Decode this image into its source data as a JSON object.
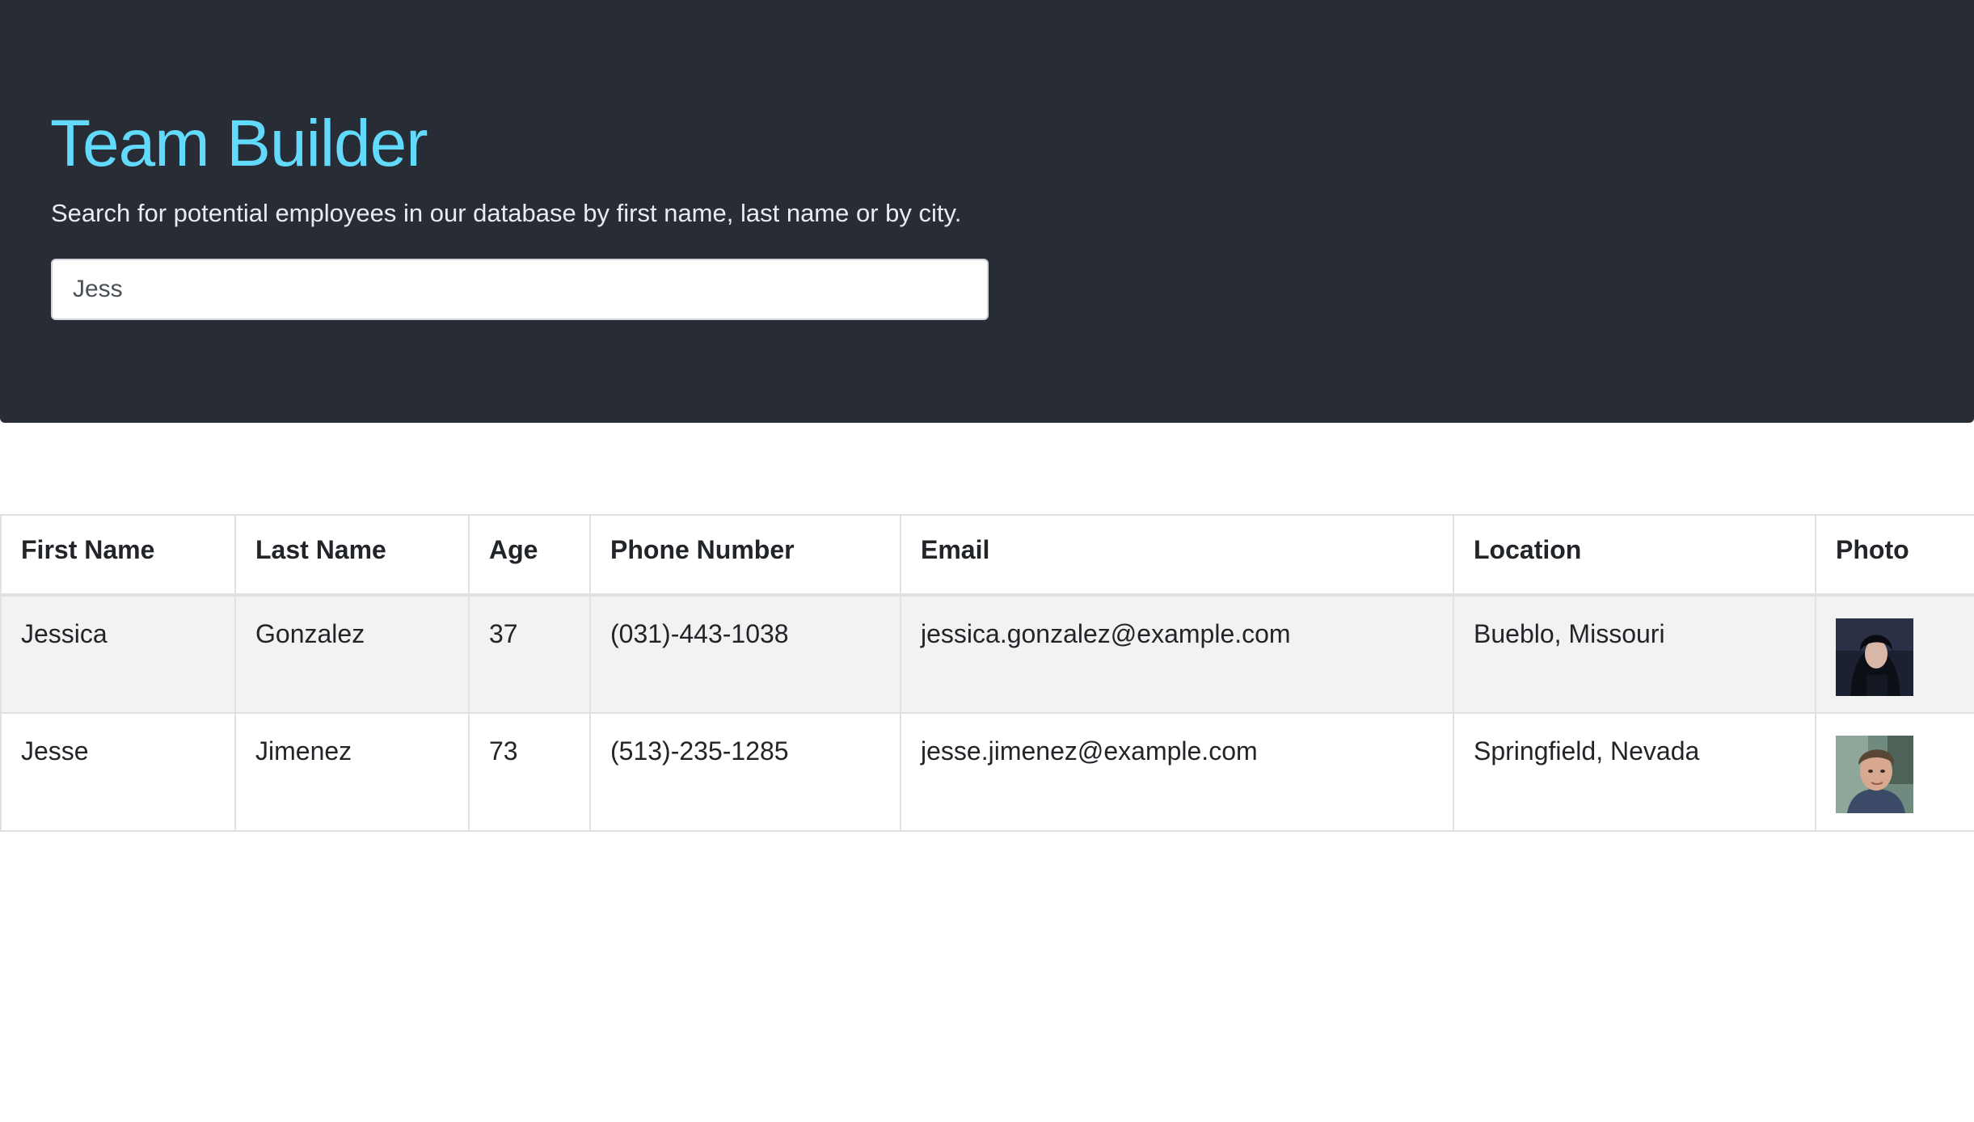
{
  "header": {
    "title": "Team Builder",
    "subtitle": "Search for potential employees in our database by first name, last name or by city.",
    "title_color": "#61dafb",
    "background_color": "#282c34"
  },
  "search": {
    "value": "Jess",
    "placeholder": ""
  },
  "table": {
    "columns": [
      "First Name",
      "Last Name",
      "Age",
      "Phone Number",
      "Email",
      "Location",
      "Photo"
    ],
    "rows": [
      {
        "first_name": "Jessica",
        "last_name": "Gonzalez",
        "age": "37",
        "phone": "(031)-443-1038",
        "email": "jessica.gonzalez@example.com",
        "location": "Bueblo, Missouri",
        "photo_icon": "avatar-photo"
      },
      {
        "first_name": "Jesse",
        "last_name": "Jimenez",
        "age": "73",
        "phone": "(513)-235-1285",
        "email": "jesse.jimenez@example.com",
        "location": "Springfield, Nevada",
        "photo_icon": "avatar-photo"
      }
    ]
  }
}
